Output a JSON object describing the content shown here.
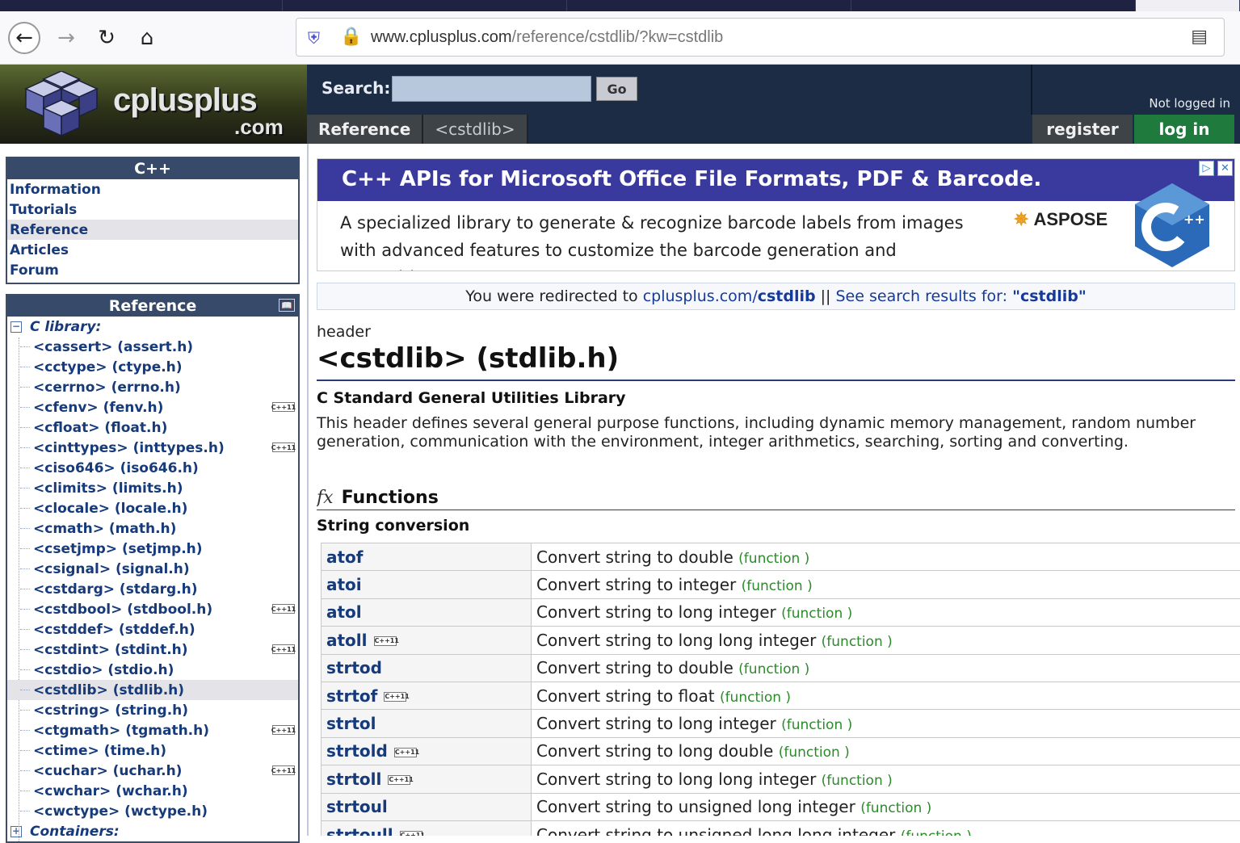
{
  "browser": {
    "url_domain": "www.cplusplus.com",
    "url_path": "/reference/cstdlib/?kw=cstdlib"
  },
  "header": {
    "logo_text": "cplusplus",
    "logo_com": ".com",
    "search_label": "Search:",
    "search_value": "",
    "go_label": "Go",
    "not_logged_in": "Not logged in",
    "breadcrumbs": [
      "Reference",
      "<cstdlib>"
    ],
    "register_label": "register",
    "login_label": "log in"
  },
  "sidebar": {
    "cpp_title": "C++",
    "cpp_items": [
      "Information",
      "Tutorials",
      "Reference",
      "Articles",
      "Forum"
    ],
    "cpp_selected": "Reference",
    "ref_title": "Reference",
    "tree_head": "C library:",
    "tree_items": [
      {
        "label": "<cassert> (assert.h)",
        "cpp11": false
      },
      {
        "label": "<cctype> (ctype.h)",
        "cpp11": false
      },
      {
        "label": "<cerrno> (errno.h)",
        "cpp11": false
      },
      {
        "label": "<cfenv> (fenv.h)",
        "cpp11": true
      },
      {
        "label": "<cfloat> (float.h)",
        "cpp11": false
      },
      {
        "label": "<cinttypes> (inttypes.h)",
        "cpp11": true
      },
      {
        "label": "<ciso646> (iso646.h)",
        "cpp11": false
      },
      {
        "label": "<climits> (limits.h)",
        "cpp11": false
      },
      {
        "label": "<clocale> (locale.h)",
        "cpp11": false
      },
      {
        "label": "<cmath> (math.h)",
        "cpp11": false
      },
      {
        "label": "<csetjmp> (setjmp.h)",
        "cpp11": false
      },
      {
        "label": "<csignal> (signal.h)",
        "cpp11": false
      },
      {
        "label": "<cstdarg> (stdarg.h)",
        "cpp11": false
      },
      {
        "label": "<cstdbool> (stdbool.h)",
        "cpp11": true
      },
      {
        "label": "<cstddef> (stddef.h)",
        "cpp11": false
      },
      {
        "label": "<cstdint> (stdint.h)",
        "cpp11": true
      },
      {
        "label": "<cstdio> (stdio.h)",
        "cpp11": false
      },
      {
        "label": "<cstdlib> (stdlib.h)",
        "cpp11": false,
        "selected": true
      },
      {
        "label": "<cstring> (string.h)",
        "cpp11": false
      },
      {
        "label": "<ctgmath> (tgmath.h)",
        "cpp11": true
      },
      {
        "label": "<ctime> (time.h)",
        "cpp11": false
      },
      {
        "label": "<cuchar> (uchar.h)",
        "cpp11": true
      },
      {
        "label": "<cwchar> (wchar.h)",
        "cpp11": false
      },
      {
        "label": "<cwctype> (wctype.h)",
        "cpp11": false
      }
    ],
    "next_head": "Containers:",
    "cpp11_badge": "C++11"
  },
  "ad": {
    "title": "C++ APIs for Microsoft Office File Formats, PDF  & Barcode.",
    "body_line1": "A specialized library to generate & recognize barcode labels from images",
    "body_line2": "with advanced features to customize the barcode generation and recognition process.",
    "brand": "ASPOSE"
  },
  "redirect": {
    "prefix": "You were redirected to ",
    "link1_domain": "cplusplus.com/",
    "link1_bold": "cstdlib",
    "separator": " || ",
    "link2_text": "See search results for: ",
    "link2_bold": "\"cstdlib\""
  },
  "page": {
    "kind": "header",
    "title": "<cstdlib> (stdlib.h)",
    "subtitle": "C Standard General Utilities Library",
    "description": "This header defines several general purpose functions, including dynamic memory management, random number generation, communication with the environment, integer arithmetics, searching, sorting and converting.",
    "functions_label": "Functions",
    "group_title": "String conversion",
    "functions": [
      {
        "name": "atof",
        "desc": "Convert string to double",
        "cpp11": false
      },
      {
        "name": "atoi",
        "desc": "Convert string to integer",
        "cpp11": false
      },
      {
        "name": "atol",
        "desc": "Convert string to long integer",
        "cpp11": false
      },
      {
        "name": "atoll",
        "desc": "Convert string to long long integer",
        "cpp11": true
      },
      {
        "name": "strtod",
        "desc": "Convert string to double",
        "cpp11": false
      },
      {
        "name": "strtof",
        "desc": "Convert string to float",
        "cpp11": true
      },
      {
        "name": "strtol",
        "desc": "Convert string to long integer",
        "cpp11": false
      },
      {
        "name": "strtold",
        "desc": "Convert string to long double",
        "cpp11": true
      },
      {
        "name": "strtoll",
        "desc": "Convert string to long long integer",
        "cpp11": true
      },
      {
        "name": "strtoul",
        "desc": "Convert string to unsigned long integer",
        "cpp11": false
      },
      {
        "name": "strtoull",
        "desc": "Convert string to unsigned long long integer",
        "cpp11": true
      }
    ],
    "kind_label": "(function )"
  }
}
